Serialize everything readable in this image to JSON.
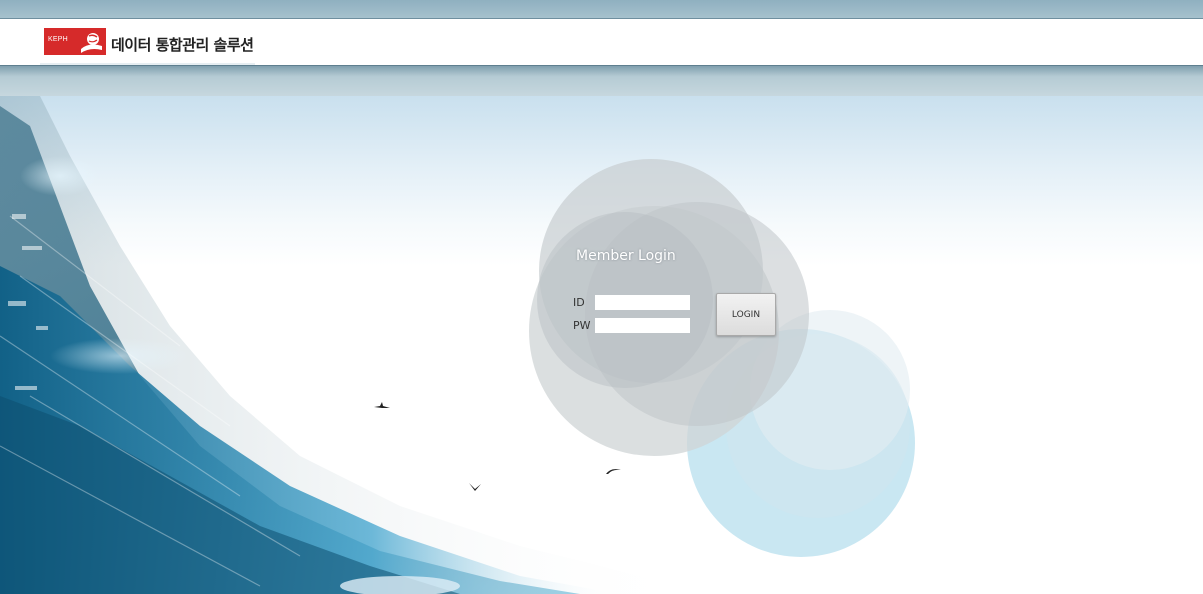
{
  "header": {
    "logo_text": "KEPH",
    "title": "데이터 통합관리 솔루션"
  },
  "login": {
    "title": "Member Login",
    "id_label": "ID",
    "pw_label": "PW",
    "id_value": "",
    "pw_value": "",
    "button_label": "LOGIN"
  },
  "icons": {
    "logo": "book-logo-icon",
    "birds": "bird-icon"
  },
  "colors": {
    "top_strip": "#8fb0c0",
    "nav_bar": "#a6c1cd",
    "logo_red": "#d62a2a",
    "circle_gray": "#c4c9cc",
    "circle_blue": "#bfe3f0"
  }
}
